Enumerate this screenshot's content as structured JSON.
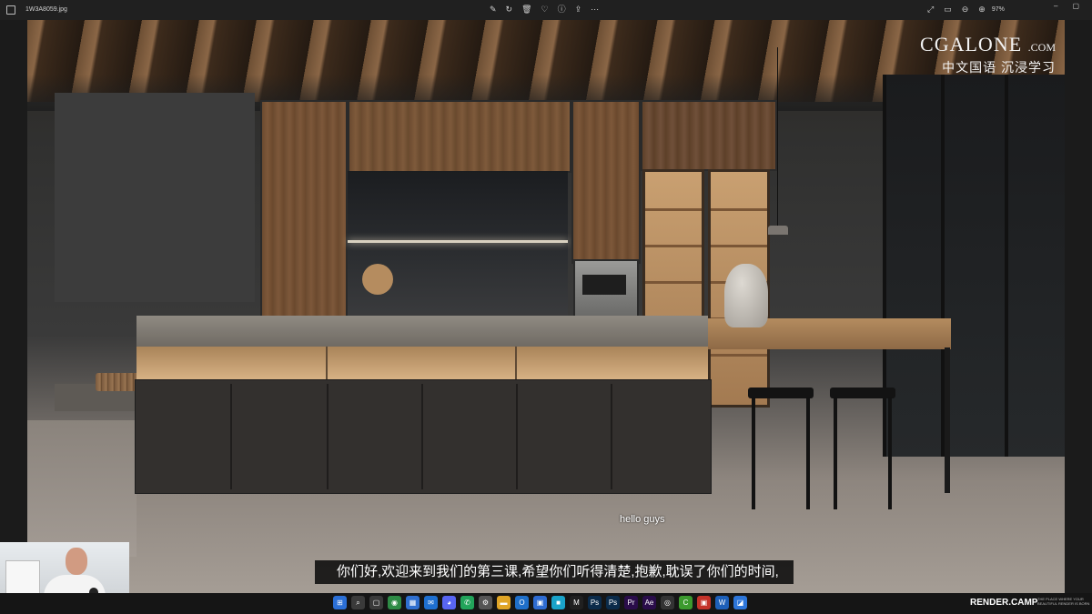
{
  "window": {
    "filename": "1W3A8059.jpg",
    "zoom": "97%",
    "toolbar_icons": [
      "edit-icon",
      "rotate-icon",
      "delete-icon",
      "favorite-icon",
      "info-icon",
      "share-icon",
      "more-icon"
    ],
    "right_icons": [
      "fullscreen-icon",
      "fit-icon",
      "zoom-out-icon",
      "zoom-in-icon"
    ]
  },
  "photo": {
    "watermark_brand": "CGALONE",
    "watermark_domain": ".COM",
    "watermark_tagline": "中文国语  沉浸学习"
  },
  "subtitles": {
    "english": "hello guys",
    "chinese": "你们好,欢迎来到我们的第三课,希望你们听得清楚,抱歉,耽误了你们的时间,"
  },
  "taskbar": {
    "icons": [
      {
        "name": "start-icon",
        "glyph": "⊞",
        "color": "#2b6fd6"
      },
      {
        "name": "search-icon",
        "glyph": "⌕",
        "color": "#3a3a3a"
      },
      {
        "name": "task-view-icon",
        "glyph": "▢",
        "color": "#3a3a3a"
      },
      {
        "name": "chrome-icon",
        "glyph": "◉",
        "color": "#2e8b45"
      },
      {
        "name": "calendar-icon",
        "glyph": "▦",
        "color": "#2f6fcf"
      },
      {
        "name": "mail-icon",
        "glyph": "✉",
        "color": "#1e6fcf"
      },
      {
        "name": "discord-icon",
        "glyph": "◕",
        "color": "#5865f2"
      },
      {
        "name": "whatsapp-icon",
        "glyph": "✆",
        "color": "#22a45a"
      },
      {
        "name": "settings-icon",
        "glyph": "⚙",
        "color": "#555"
      },
      {
        "name": "folder-icon",
        "glyph": "▬",
        "color": "#e0a526"
      },
      {
        "name": "outlook-icon",
        "glyph": "O",
        "color": "#1f6fc9"
      },
      {
        "name": "store-icon",
        "glyph": "▣",
        "color": "#2e6bd1"
      },
      {
        "name": "media-icon",
        "glyph": "■",
        "color": "#1aa3c9"
      },
      {
        "name": "m-app-icon",
        "glyph": "M",
        "color": "#202020"
      },
      {
        "name": "photoshop-icon",
        "glyph": "Ps",
        "color": "#0b2b4a"
      },
      {
        "name": "photoshop-2-icon",
        "glyph": "Ps",
        "color": "#0b2b4a"
      },
      {
        "name": "premiere-icon",
        "glyph": "Pr",
        "color": "#2a0d4a"
      },
      {
        "name": "after-effects-icon",
        "glyph": "Ae",
        "color": "#2a0d4a"
      },
      {
        "name": "obs-icon",
        "glyph": "◎",
        "color": "#333"
      },
      {
        "name": "green-app-icon",
        "glyph": "C",
        "color": "#3c9a2e"
      },
      {
        "name": "red-app-icon",
        "glyph": "▣",
        "color": "#c4332a"
      },
      {
        "name": "word-icon",
        "glyph": "W",
        "color": "#1d5fb8"
      },
      {
        "name": "photos-icon",
        "glyph": "◪",
        "color": "#2d75d8"
      }
    ]
  },
  "branding": {
    "logo": "RENDER.CAMP",
    "tagline": "THE PLACE WHERE YOUR BEAUTIFUL RENDER IS BORN"
  }
}
